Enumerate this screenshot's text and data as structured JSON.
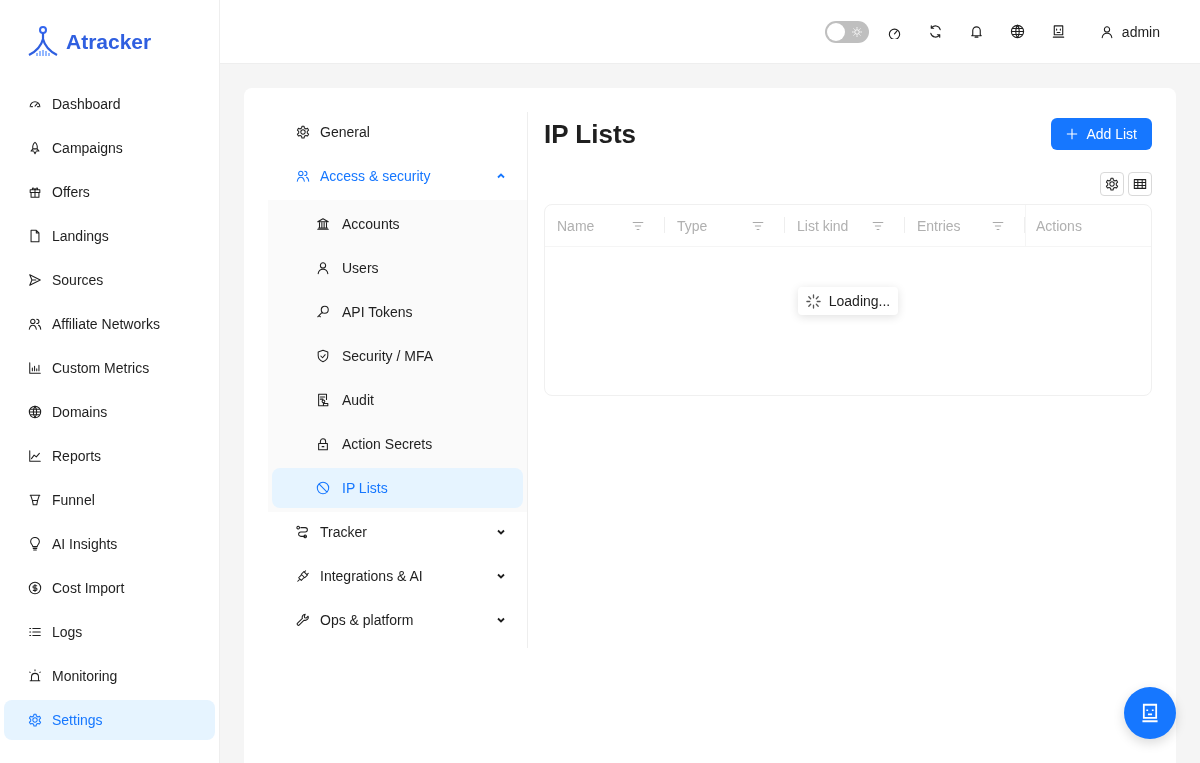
{
  "logo": {
    "text": "Atracker"
  },
  "header": {
    "theme_toggle": {
      "on": false
    },
    "user": "admin"
  },
  "sidebar": {
    "items": [
      {
        "label": "Dashboard",
        "selected": false
      },
      {
        "label": "Campaigns",
        "selected": false
      },
      {
        "label": "Offers",
        "selected": false
      },
      {
        "label": "Landings",
        "selected": false
      },
      {
        "label": "Sources",
        "selected": false
      },
      {
        "label": "Affiliate Networks",
        "selected": false
      },
      {
        "label": "Custom Metrics",
        "selected": false
      },
      {
        "label": "Domains",
        "selected": false
      },
      {
        "label": "Reports",
        "selected": false
      },
      {
        "label": "Funnel",
        "selected": false
      },
      {
        "label": "AI Insights",
        "selected": false
      },
      {
        "label": "Cost Import",
        "selected": false
      },
      {
        "label": "Logs",
        "selected": false
      },
      {
        "label": "Monitoring",
        "selected": false
      },
      {
        "label": "Settings",
        "selected": true
      }
    ]
  },
  "settings_menu": {
    "items": [
      {
        "label": "General",
        "kind": "item",
        "selected": false
      },
      {
        "label": "Access & security",
        "kind": "group",
        "expanded": true,
        "selected": true,
        "children": [
          {
            "label": "Accounts",
            "selected": false
          },
          {
            "label": "Users",
            "selected": false
          },
          {
            "label": "API Tokens",
            "selected": false
          },
          {
            "label": "Security / MFA",
            "selected": false
          },
          {
            "label": "Audit",
            "selected": false
          },
          {
            "label": "Action Secrets",
            "selected": false
          },
          {
            "label": "IP Lists",
            "selected": true
          }
        ]
      },
      {
        "label": "Tracker",
        "kind": "group",
        "expanded": false,
        "selected": false
      },
      {
        "label": "Integrations & AI",
        "kind": "group",
        "expanded": false,
        "selected": false
      },
      {
        "label": "Ops & platform",
        "kind": "group",
        "expanded": false,
        "selected": false
      }
    ]
  },
  "page": {
    "title": "IP Lists",
    "add_button": "Add List",
    "table": {
      "columns": [
        {
          "label": "Name",
          "filterable": true
        },
        {
          "label": "Type",
          "filterable": true
        },
        {
          "label": "List kind",
          "filterable": true
        },
        {
          "label": "Entries",
          "filterable": true
        },
        {
          "label": "Actions",
          "filterable": false
        }
      ],
      "loading": "Loading..."
    }
  }
}
